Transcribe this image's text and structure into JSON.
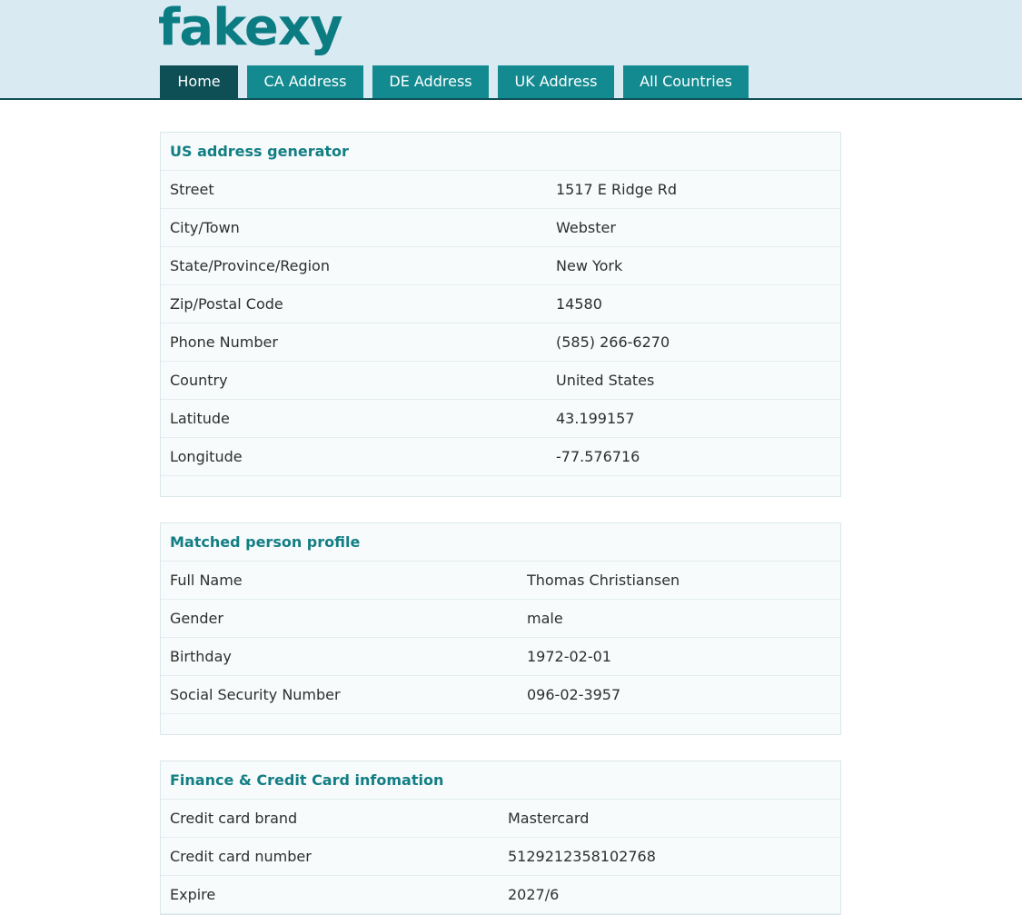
{
  "site": {
    "logo": "fakexy"
  },
  "nav": {
    "items": [
      {
        "label": "Home",
        "active": true
      },
      {
        "label": "CA Address",
        "active": false
      },
      {
        "label": "DE Address",
        "active": false
      },
      {
        "label": "UK Address",
        "active": false
      },
      {
        "label": "All Countries",
        "active": false
      }
    ]
  },
  "address": {
    "title": "US address generator",
    "rows": [
      {
        "label": "Street",
        "value": "1517 E Ridge Rd"
      },
      {
        "label": "City/Town",
        "value": "Webster"
      },
      {
        "label": "State/Province/Region",
        "value": "New York"
      },
      {
        "label": "Zip/Postal Code",
        "value": "14580"
      },
      {
        "label": "Phone Number",
        "value": "(585) 266-6270"
      },
      {
        "label": "Country",
        "value": "United States"
      },
      {
        "label": "Latitude",
        "value": "43.199157"
      },
      {
        "label": "Longitude",
        "value": "-77.576716"
      }
    ]
  },
  "person": {
    "title": "Matched person profile",
    "rows": [
      {
        "label": "Full Name",
        "value": "Thomas Christiansen"
      },
      {
        "label": "Gender",
        "value": "male"
      },
      {
        "label": "Birthday",
        "value": "1972-02-01"
      },
      {
        "label": "Social Security Number",
        "value": "096-02-3957"
      }
    ]
  },
  "finance": {
    "title": "Finance & Credit Card infomation",
    "rows": [
      {
        "label": "Credit card brand",
        "value": "Mastercard"
      },
      {
        "label": "Credit card number",
        "value": "5129212358102768"
      },
      {
        "label": "Expire",
        "value": "2027/6"
      }
    ]
  },
  "colors": {
    "header_bg": "#daeaf2",
    "accent": "#138a8f",
    "accent_dark": "#0d4f55",
    "title_text": "#137e84"
  }
}
